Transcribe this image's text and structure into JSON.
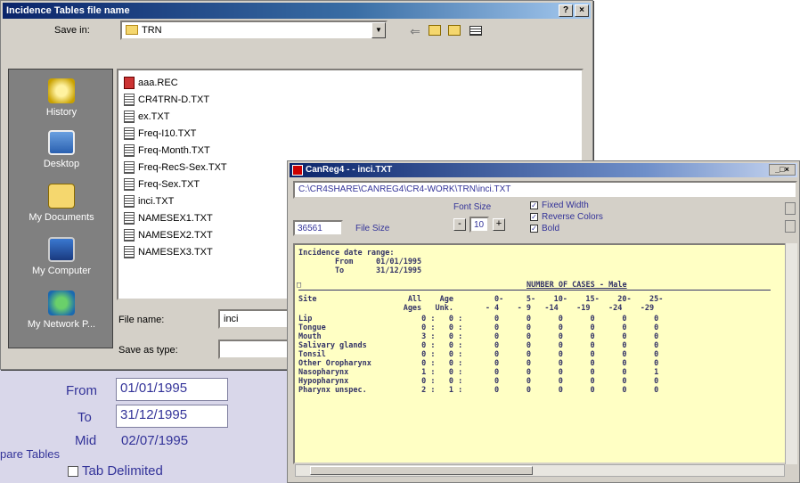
{
  "background": {
    "from_label": "From",
    "from_value": "01/01/1995",
    "to_label": "To",
    "to_value": "31/12/1995",
    "mid_label": "Mid",
    "mid_value": "02/07/1995",
    "prepare_tables": "pare Tables",
    "tab_delimited": "Tab Delimited"
  },
  "save_dialog": {
    "title": "Incidence Tables file name",
    "help_btn": "?",
    "close_btn": "×",
    "save_in_label": "Save in:",
    "save_in_value": "TRN",
    "places": [
      "History",
      "Desktop",
      "My Documents",
      "My Computer",
      "My Network P..."
    ],
    "files": [
      {
        "name": "aaa.REC",
        "type": "rec"
      },
      {
        "name": "CR4TRN-D.TXT",
        "type": "txt"
      },
      {
        "name": "ex.TXT",
        "type": "txt"
      },
      {
        "name": "Freq-I10.TXT",
        "type": "txt"
      },
      {
        "name": "Freq-Month.TXT",
        "type": "txt"
      },
      {
        "name": "Freq-RecS-Sex.TXT",
        "type": "txt"
      },
      {
        "name": "Freq-Sex.TXT",
        "type": "txt"
      },
      {
        "name": "inci.TXT",
        "type": "txt"
      },
      {
        "name": "NAMESEX1.TXT",
        "type": "txt"
      },
      {
        "name": "NAMESEX2.TXT",
        "type": "txt"
      },
      {
        "name": "NAMESEX3.TXT",
        "type": "txt"
      }
    ],
    "file_name_label": "File name:",
    "file_name_value": "inci",
    "save_as_type_label": "Save as type:",
    "save_as_type_value": ""
  },
  "canreg": {
    "title": "CanReg4 - - inci.TXT",
    "path": "C:\\CR4SHARE\\CANREG4\\CR4-WORK\\TRN\\inci.TXT",
    "file_size_value": "36561",
    "file_size_label": "File Size",
    "font_size_label": "Font Size",
    "font_size_value": "10",
    "minus_btn": "-",
    "plus_btn": "+",
    "check_fixed_width": "Fixed Width",
    "check_reverse_colors": "Reverse Colors",
    "check_bold": "Bold",
    "report_lines": [
      "Incidence date range:",
      "        From     01/01/1995",
      "        To       31/12/1995",
      "",
      "Site                    All    Age         0-     5-    10-    15-    20-    25-",
      "                       Ages   Unk.       - 4    - 9   -14    -19    -24    -29",
      "Lip                        0 :   0 :       0      0      0      0      0      0",
      "Tongue                     0 :   0 :       0      0      0      0      0      0",
      "Mouth                      3 :   0 :       0      0      0      0      0      0",
      "Salivary glands            0 :   0 :       0      0      0      0      0      0",
      "Tonsil                     0 :   0 :       0      0      0      0      0      0",
      "Other Oropharynx           0 :   0 :       0      0      0      0      0      0",
      "Nasopharynx                1 :   0 :       0      0      0      0      0      1",
      "Hypopharynx                0 :   0 :       0      0      0      0      0      0",
      "Pharynx unspec.            2 :   1 :       0      0      0      0      0      0"
    ],
    "report_header": "NUMBER OF CASES - Male"
  }
}
